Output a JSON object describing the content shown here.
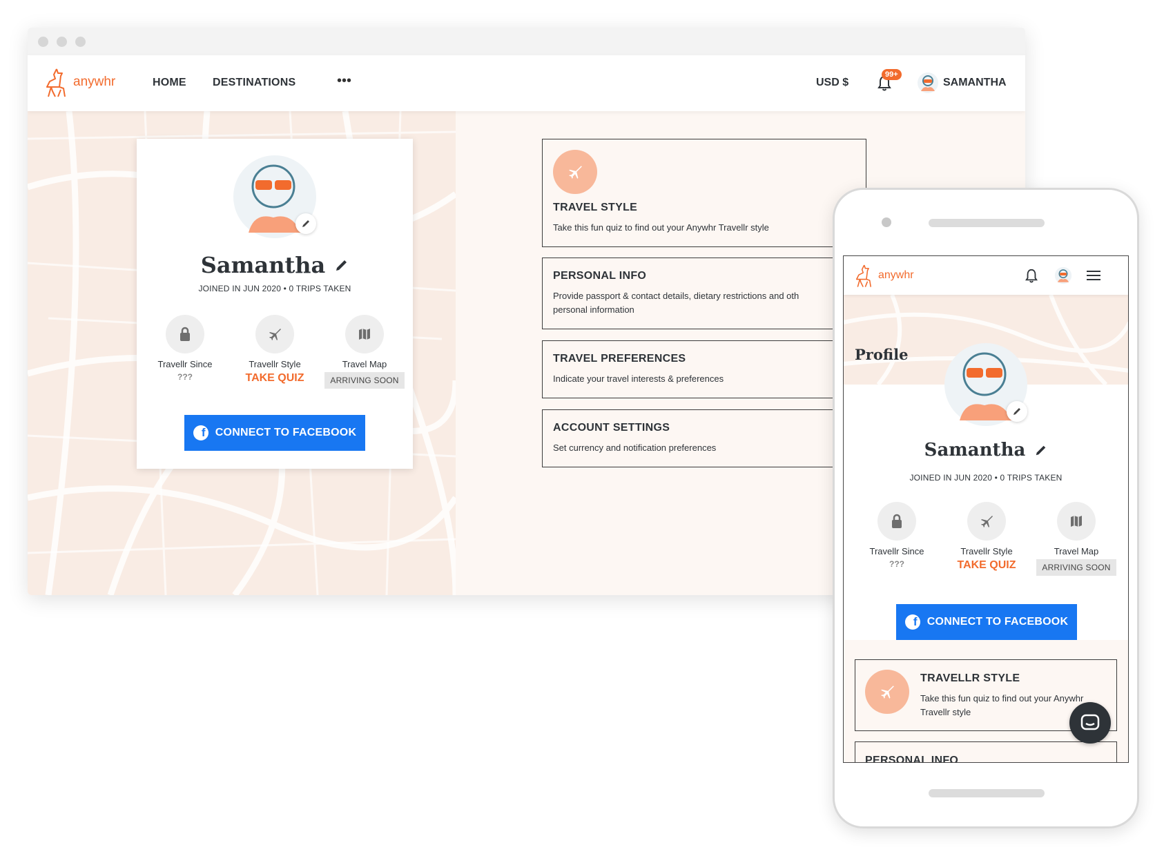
{
  "brand": {
    "name": "anywhr",
    "accent": "#f26b2d",
    "facebook_blue": "#1877f2"
  },
  "desktop": {
    "nav": {
      "links": [
        "HOME",
        "DESTINATIONS"
      ],
      "more": "•••",
      "currency": "USD $",
      "notification_badge": "99+",
      "user": "SAMANTHA"
    },
    "profile": {
      "name": "Samantha",
      "joined": "JOINED IN JUN 2020 • 0 TRIPS TAKEN",
      "stats": [
        {
          "icon": "lock-icon",
          "label": "Travellr Since",
          "value": "???"
        },
        {
          "icon": "airplane-icon",
          "label": "Travellr Style",
          "value": "TAKE QUIZ"
        },
        {
          "icon": "map-icon",
          "label": "Travel Map",
          "value": "ARRIVING SOON"
        }
      ],
      "facebook_button": "CONNECT TO FACEBOOK"
    },
    "sections": [
      {
        "title": "TRAVEL STYLE",
        "desc": "Take this fun quiz to find out your Anywhr Travellr style"
      },
      {
        "title": "PERSONAL INFO",
        "desc_line1": "Provide passport & contact details, dietary restrictions  and oth",
        "desc_line2": "personal information"
      },
      {
        "title": "TRAVEL PREFERENCES",
        "desc": "Indicate your travel interests & preferences"
      },
      {
        "title": "ACCOUNT SETTINGS",
        "desc": "Set currency and notification preferences"
      }
    ]
  },
  "mobile": {
    "page_title": "Profile",
    "profile": {
      "name": "Samantha",
      "joined": "JOINED IN JUN 2020 • 0 TRIPS TAKEN",
      "stats": [
        {
          "label": "Travellr Since",
          "value": "???"
        },
        {
          "label": "Travellr Style",
          "value": "TAKE QUIZ"
        },
        {
          "label": "Travel Map",
          "value": "ARRIVING SOON"
        }
      ],
      "facebook_button": "CONNECT TO FACEBOOK"
    },
    "cards": [
      {
        "title": "TRAVELLR STYLE",
        "desc_line1": "Take this fun quiz to find out your Anywhr",
        "desc_line2": "Travellr style"
      },
      {
        "title": "PERSONAL INFO"
      }
    ]
  }
}
